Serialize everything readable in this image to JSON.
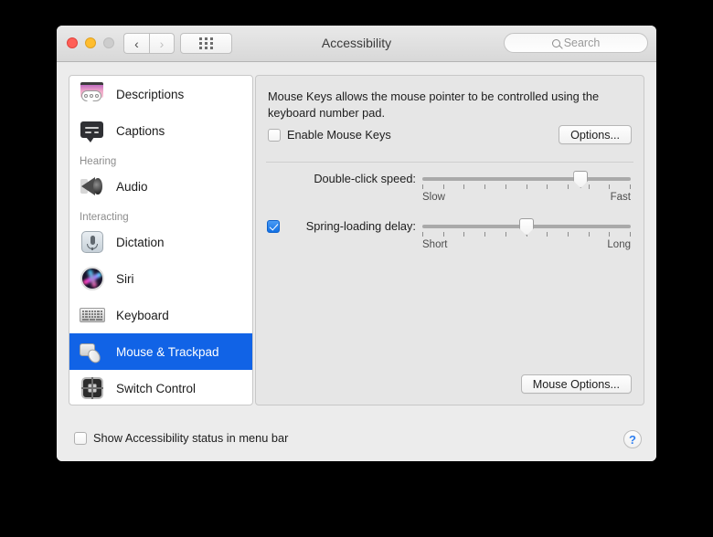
{
  "window": {
    "title": "Accessibility",
    "traffic_lights": [
      "close",
      "minimize",
      "zoom"
    ],
    "nav_back": "‹",
    "nav_forward": "›",
    "show_all_icon": "grid-icon"
  },
  "search": {
    "placeholder": "Search",
    "value": "",
    "icon": "search-icon"
  },
  "sidebar": {
    "items": [
      {
        "type": "item",
        "label": "Descriptions",
        "icon": "descriptions-icon",
        "selected": false
      },
      {
        "type": "item",
        "label": "Captions",
        "icon": "captions-icon",
        "selected": false
      },
      {
        "type": "header",
        "label": "Hearing"
      },
      {
        "type": "item",
        "label": "Audio",
        "icon": "audio-speaker-icon",
        "selected": false
      },
      {
        "type": "header",
        "label": "Interacting"
      },
      {
        "type": "item",
        "label": "Dictation",
        "icon": "dictation-mic-icon",
        "selected": false
      },
      {
        "type": "item",
        "label": "Siri",
        "icon": "siri-icon",
        "selected": false
      },
      {
        "type": "item",
        "label": "Keyboard",
        "icon": "keyboard-icon",
        "selected": false
      },
      {
        "type": "item",
        "label": "Mouse & Trackpad",
        "icon": "mouse-trackpad-icon",
        "selected": true
      },
      {
        "type": "item",
        "label": "Switch Control",
        "icon": "switch-control-icon",
        "selected": false
      }
    ],
    "selection_color": "#1163e6"
  },
  "pane": {
    "description": "Mouse Keys allows the mouse pointer to be controlled using the keyboard number pad.",
    "enable_mouse_keys": {
      "label": "Enable Mouse Keys",
      "checked": false
    },
    "options_button": "Options...",
    "mouse_options_button": "Mouse Options...",
    "sliders": [
      {
        "label": "Double-click speed:",
        "has_checkbox": false,
        "checked": false,
        "min_label": "Slow",
        "max_label": "Fast",
        "ticks": 11,
        "value_percent": 76
      },
      {
        "label": "Spring-loading delay:",
        "has_checkbox": true,
        "checked": true,
        "min_label": "Short",
        "max_label": "Long",
        "ticks": 11,
        "value_percent": 50
      }
    ]
  },
  "footer": {
    "show_status": {
      "label": "Show Accessibility status in menu bar",
      "checked": false
    },
    "help_button": "?",
    "help_icon": "question-mark-icon",
    "help_color": "#2f7ff0"
  }
}
